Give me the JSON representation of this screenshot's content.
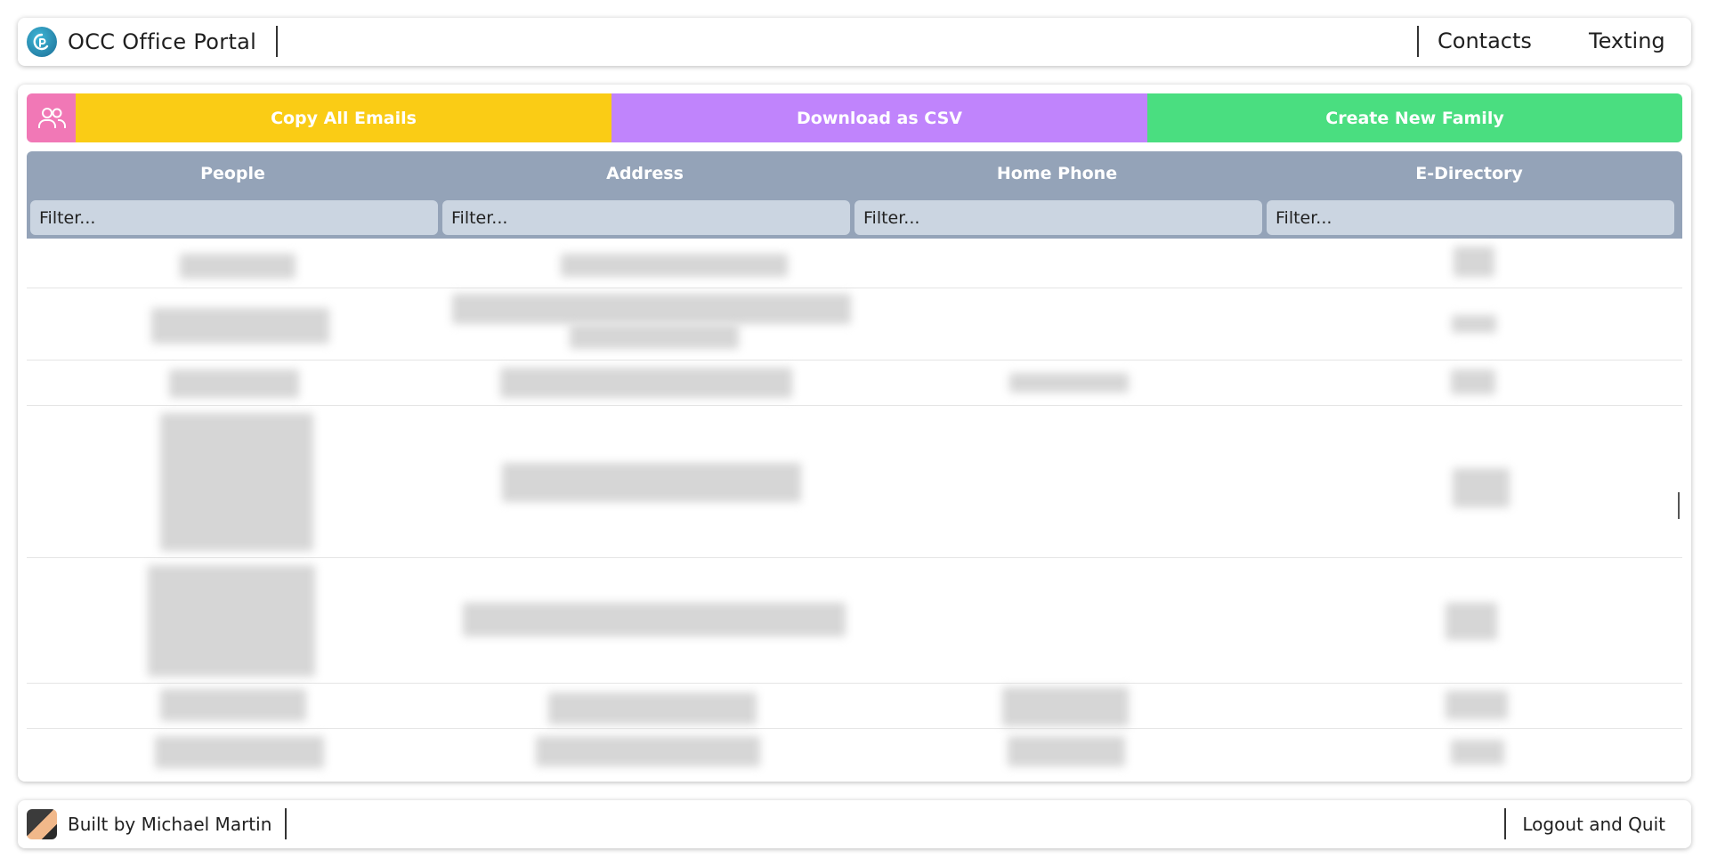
{
  "header": {
    "app_title": "OCC Office Portal",
    "logo_icon": "portal-logo-icon",
    "nav": [
      {
        "label": "Contacts"
      },
      {
        "label": "Texting"
      }
    ]
  },
  "toolbar": {
    "family_icon": "users-icon",
    "copy_emails_label": "Copy All Emails",
    "download_csv_label": "Download as CSV",
    "create_family_label": "Create New Family",
    "colors": {
      "icon_bg": "#f178b6",
      "copy": "#facc15",
      "csv": "#c084fc",
      "create": "#4ade80"
    }
  },
  "table": {
    "header_color": "#94a3b8",
    "columns": [
      {
        "title": "People",
        "filter_placeholder": "Filter..."
      },
      {
        "title": "Address",
        "filter_placeholder": "Filter..."
      },
      {
        "title": "Home Phone",
        "filter_placeholder": "Filter..."
      },
      {
        "title": "E-Directory",
        "filter_placeholder": "Filter..."
      }
    ],
    "rows_note": "row contents are blurred/redacted in the screenshot"
  },
  "footer": {
    "avatar_icon": "author-avatar",
    "built_by": "Built by Michael Martin",
    "logout_label": "Logout and Quit"
  }
}
